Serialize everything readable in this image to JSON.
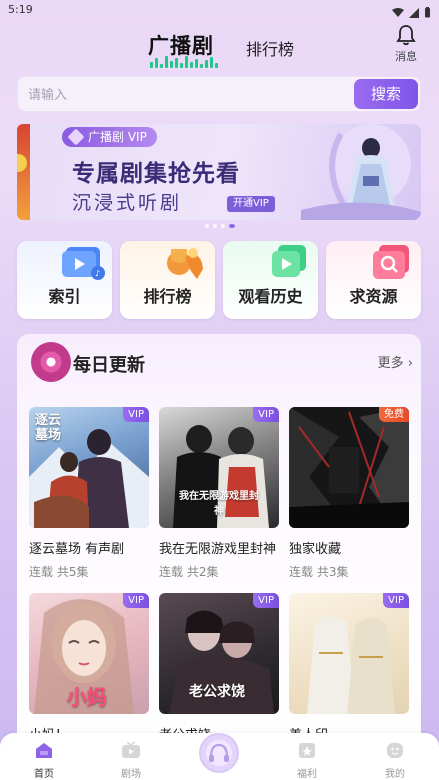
{
  "status_bar": {
    "time": "5:19"
  },
  "header": {
    "logo": "广播剧",
    "rank_tab": "排行榜",
    "message_label": "消息"
  },
  "search": {
    "placeholder": "请输入",
    "button": "搜索"
  },
  "banner": {
    "badge": "广播剧 VIP",
    "title": "专属剧集抢先看",
    "subtitle": "沉浸式听剧",
    "cta": "开通VIP"
  },
  "quick_links": [
    {
      "label": "索引",
      "icon": "video-folder-icon"
    },
    {
      "label": "排行榜",
      "icon": "trophy-icon"
    },
    {
      "label": "观看历史",
      "icon": "history-play-icon"
    },
    {
      "label": "求资源",
      "icon": "search-folder-icon"
    }
  ],
  "daily": {
    "title": "每日更新",
    "more": "更多",
    "items": [
      {
        "title": "逐云墓场 有声剧",
        "meta": "连载 共5集",
        "badge": "VIP",
        "badge_type": "vip",
        "cover_text": "逐云墓场"
      },
      {
        "title": "我在无限游戏里封神",
        "meta": "连载 共2集",
        "badge": "VIP",
        "badge_type": "vip",
        "cover_text": "我在无限游戏里封神"
      },
      {
        "title": "独家收藏",
        "meta": "连载 共3集",
        "badge": "免费",
        "badge_type": "free",
        "cover_text": ""
      },
      {
        "title": "小妈！",
        "meta": "",
        "badge": "VIP",
        "badge_type": "vip",
        "cover_text": "小妈"
      },
      {
        "title": "老公求饶",
        "meta": "",
        "badge": "VIP",
        "badge_type": "vip",
        "cover_text": "老公求饶"
      },
      {
        "title": "美人印",
        "meta": "",
        "badge": "VIP",
        "badge_type": "vip",
        "cover_text": ""
      }
    ]
  },
  "tabbar": [
    {
      "label": "首页",
      "active": true
    },
    {
      "label": "剧场",
      "active": false
    },
    {
      "label": "福利",
      "active": false
    },
    {
      "label": "我的",
      "active": false
    }
  ],
  "colors": {
    "accent": "#8d63ea",
    "free_badge": "#e84a2a",
    "brand_wave": "#1dc88a"
  }
}
